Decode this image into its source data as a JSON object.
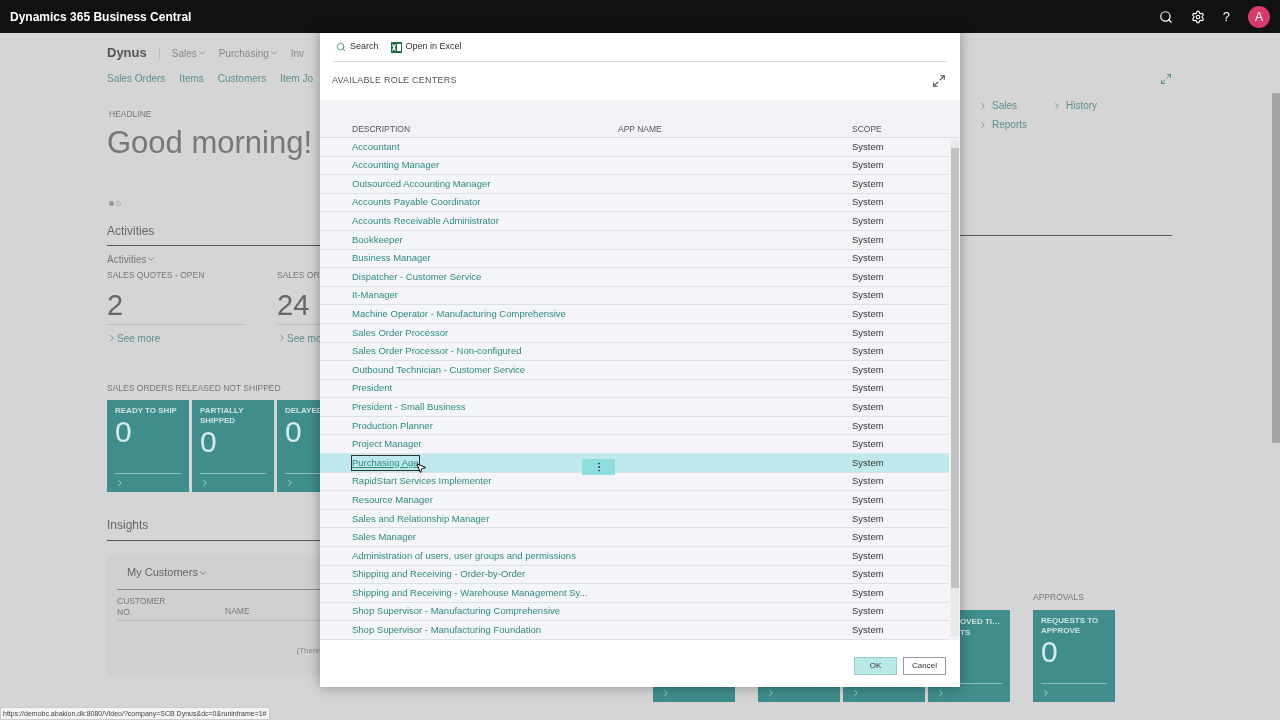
{
  "app_bar": {
    "title": "Dynamics 365 Business Central",
    "help": "?",
    "avatar": "A"
  },
  "page": {
    "company": "Dynus",
    "menus": [
      "Sales",
      "Purchasing",
      "Inv"
    ],
    "nav_links": [
      "Sales Orders",
      "Items",
      "Customers",
      "Item Jo"
    ],
    "headline_label": "HEADLINE",
    "headline": "Good morning!",
    "activities_title": "Activities",
    "activities_menu": "Activities",
    "cues": [
      {
        "label": "SALES QUOTES - OPEN",
        "value": "2",
        "link": "See more"
      },
      {
        "label": "SALES OR",
        "value": "24",
        "link": "See mo"
      }
    ],
    "tiles_label": "SALES ORDERS RELEASED NOT SHIPPED",
    "tiles": [
      {
        "label": "READY TO SHIP",
        "value": "0"
      },
      {
        "label": "PARTIALLY SHIPPED",
        "value": "0"
      },
      {
        "label": "DELAYED",
        "value": "0"
      }
    ],
    "insights_title": "Insights",
    "customers_menu": "My Customers",
    "customer_columns": [
      "CUSTOMER NO.",
      "NAME"
    ],
    "customers_empty": "(There",
    "right_links": [
      "Sales",
      "History",
      "Reports"
    ],
    "approvals_label": "APPROVALS",
    "bottom_tiles": [
      {
        "kind": "blank"
      },
      {
        "kind": "blank"
      },
      {
        "kind": "blank"
      },
      {
        "kind": "labeled",
        "lines": [
          "OVED TI…",
          "TS"
        ]
      }
    ],
    "approvals_tile": {
      "label": "REQUESTS TO APPROVE",
      "value": "0"
    }
  },
  "dialog": {
    "actions": [
      "Search",
      "Open in Excel"
    ],
    "title": "AVAILABLE ROLE CENTERS",
    "columns": [
      "DESCRIPTION",
      "APP NAME",
      "SCOPE"
    ],
    "rows": [
      {
        "description": "Accountant",
        "scope": "System",
        "selected": false
      },
      {
        "description": "Accounting Manager",
        "scope": "System",
        "selected": false
      },
      {
        "description": "Outsourced Accounting Manager",
        "scope": "System",
        "selected": false
      },
      {
        "description": "Accounts Payable Coordinator",
        "scope": "System",
        "selected": false
      },
      {
        "description": "Accounts Receivable Administrator",
        "scope": "System",
        "selected": false
      },
      {
        "description": "Bookkeeper",
        "scope": "System",
        "selected": false
      },
      {
        "description": "Business Manager",
        "scope": "System",
        "selected": false
      },
      {
        "description": "Dispatcher - Customer Service",
        "scope": "System",
        "selected": false
      },
      {
        "description": "It-Manager",
        "scope": "System",
        "selected": false
      },
      {
        "description": "Machine Operator - Manufacturing Comprehensive",
        "scope": "System",
        "selected": false
      },
      {
        "description": "Sales Order Processor",
        "scope": "System",
        "selected": false
      },
      {
        "description": "Sales Order Processor - Non-configured",
        "scope": "System",
        "selected": false
      },
      {
        "description": "Outbound Technician - Customer Service",
        "scope": "System",
        "selected": false
      },
      {
        "description": "President",
        "scope": "System",
        "selected": false
      },
      {
        "description": "President - Small Business",
        "scope": "System",
        "selected": false
      },
      {
        "description": "Production Planner",
        "scope": "System",
        "selected": false
      },
      {
        "description": "Project Manager",
        "scope": "System",
        "selected": false
      },
      {
        "description": "Purchasing Age",
        "scope": "System",
        "selected": true
      },
      {
        "description": "RapidStart Services Implementer",
        "scope": "System",
        "selected": false
      },
      {
        "description": "Resource Manager",
        "scope": "System",
        "selected": false
      },
      {
        "description": "Sales and Relationship Manager",
        "scope": "System",
        "selected": false
      },
      {
        "description": "Sales Manager",
        "scope": "System",
        "selected": false
      },
      {
        "description": "Administration of users, user groups and permissions",
        "scope": "System",
        "selected": false
      },
      {
        "description": "Shipping and Receiving - Order-by-Order",
        "scope": "System",
        "selected": false
      },
      {
        "description": "Shipping and Receiving - Warehouse Management Sy...",
        "scope": "System",
        "selected": false
      },
      {
        "description": "Shop Supervisor - Manufacturing Comprehensive",
        "scope": "System",
        "selected": false
      },
      {
        "description": "Shop Supervisor - Manufacturing Foundation",
        "scope": "System",
        "selected": false
      }
    ],
    "buttons": [
      "OK",
      "Cancel"
    ]
  },
  "status_url": "https://demobc.abakion.dk:8080/Video/?company=SCB Dynus&dc=0&runinframe=1#"
}
